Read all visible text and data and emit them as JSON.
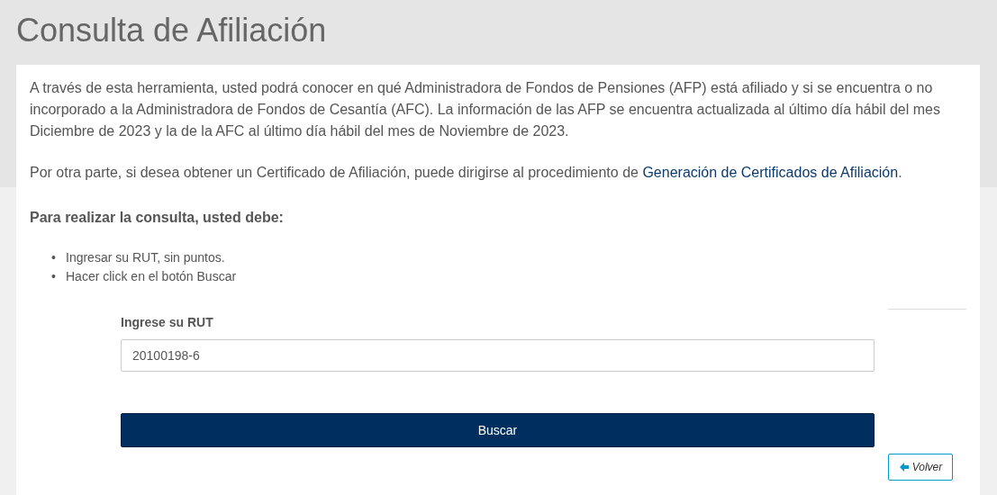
{
  "title": "Consulta de Afiliación",
  "intro": "A través de esta herramienta, usted podrá conocer en qué Administradora de Fondos de Pensiones (AFP) está afiliado y si se encuentra o no incorporado a la Administradora de Fondos de Cesantía (AFC). La información de las AFP se encuentra actualizada al último día hábil del mes Diciembre de 2023 y la de la AFC al último día hábil del mes de Noviembre de 2023.",
  "certificate": {
    "before": "Por otra parte, si desea obtener un Certificado de Afiliación, puede dirigirse al procedimiento de ",
    "link": "Generación de Certificados de Afiliación",
    "after": "."
  },
  "steps_heading": "Para realizar la consulta, usted debe:",
  "steps": [
    {
      "marker": "•",
      "text": "Ingresar su RUT, sin puntos."
    },
    {
      "marker": "•",
      "text": "Hacer click en el botón Buscar"
    }
  ],
  "rut_field": {
    "label": "Ingrese su RUT",
    "value": "20100198-6"
  },
  "search_button": "Buscar",
  "back_button": "Volver"
}
